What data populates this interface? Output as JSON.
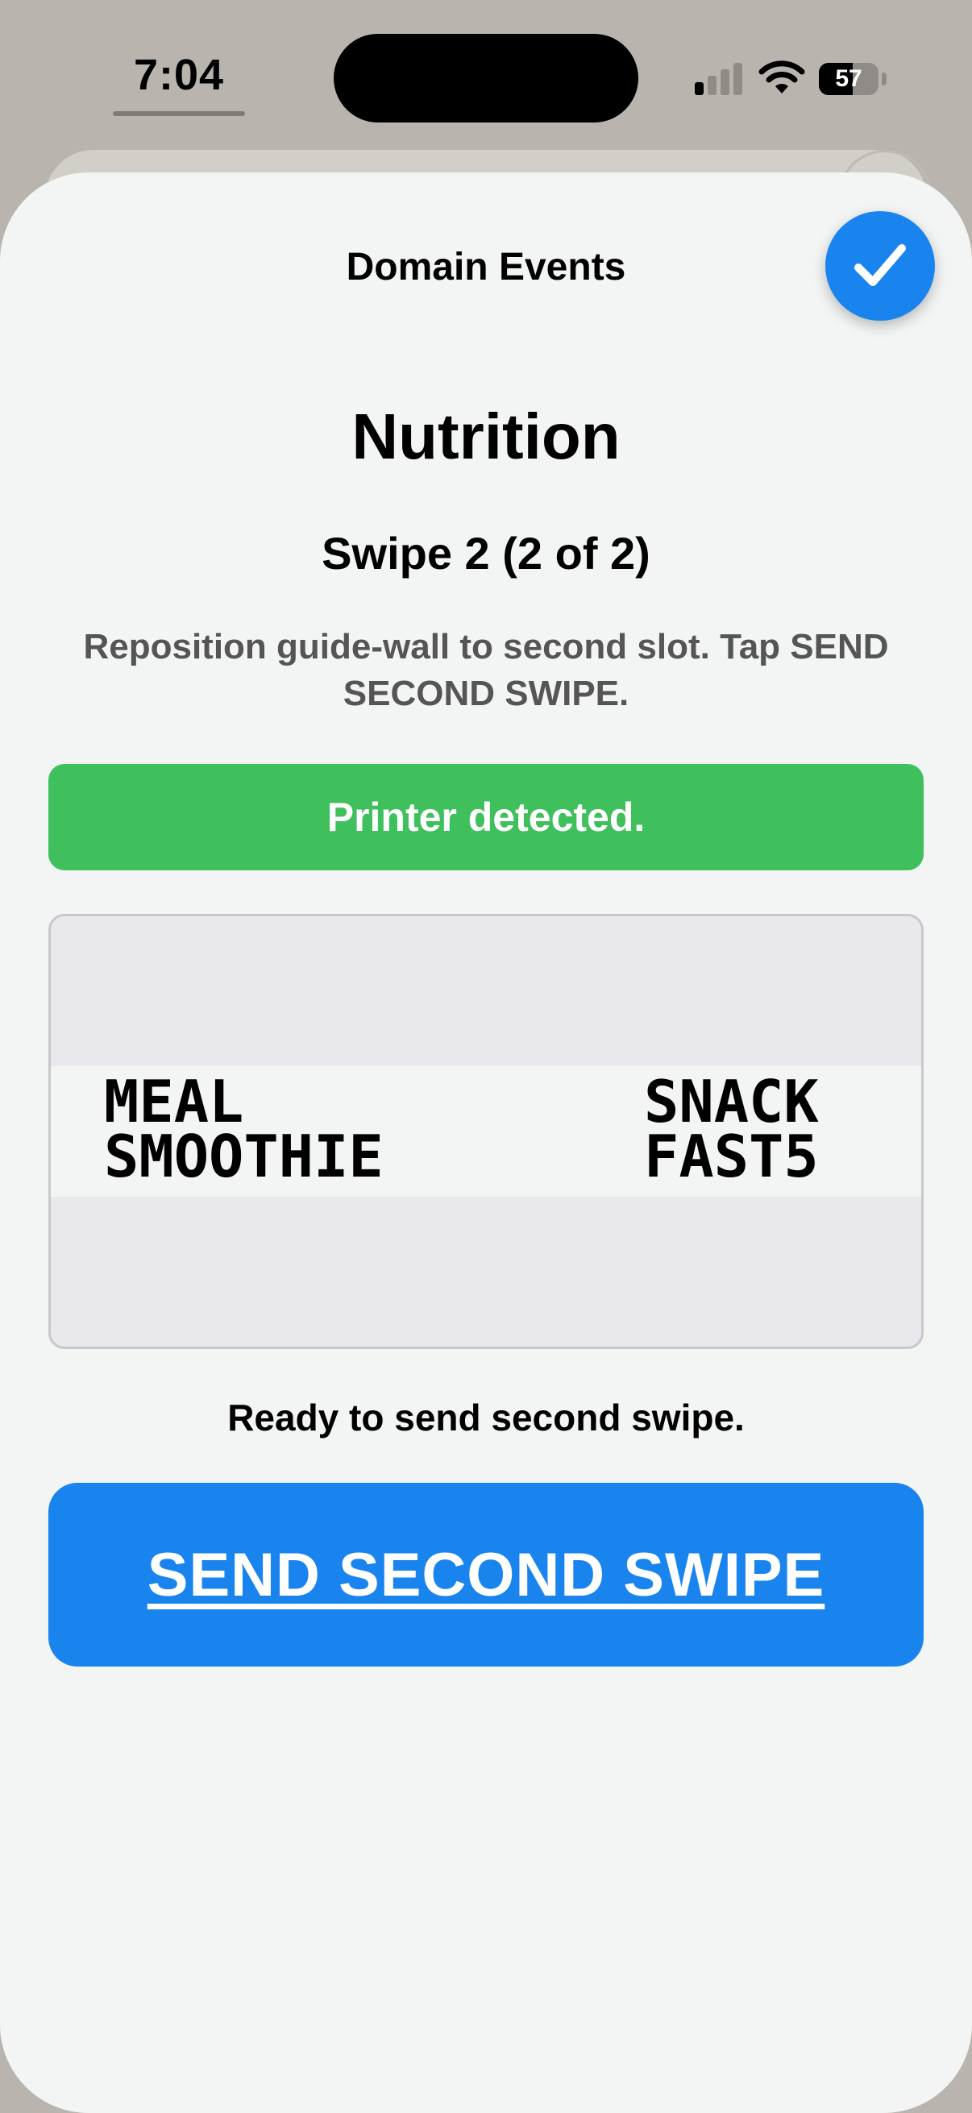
{
  "status_bar": {
    "time": "7:04",
    "battery_percent": "57",
    "battery_level": 0.57,
    "signal_bars_active": 1,
    "signal_bars_total": 4
  },
  "sheet": {
    "title": "Domain Events"
  },
  "content": {
    "heading": "Nutrition",
    "step": "Swipe 2 (2 of 2)",
    "instructions": "Reposition guide-wall to second slot. Tap SEND SECOND SWIPE.",
    "printer_status": "Printer detected.",
    "preview": {
      "left_line1": "MEAL",
      "left_line2": "SMOOTHIE",
      "right_line1": "SNACK",
      "right_line2": "FAST5"
    },
    "ready_message": "Ready to send second swipe.",
    "send_button_label": "SEND SECOND SWIPE"
  },
  "icons": {
    "done": "checkmark-icon",
    "signal": "cellular-signal-icon",
    "wifi": "wifi-icon",
    "battery": "battery-icon"
  },
  "colors": {
    "accent_blue": "#1a84ee",
    "success_green": "#3fc05d",
    "sheet_background": "#f3f5f5",
    "backdrop": "#b9b5ae",
    "secondary_text": "#555555"
  }
}
